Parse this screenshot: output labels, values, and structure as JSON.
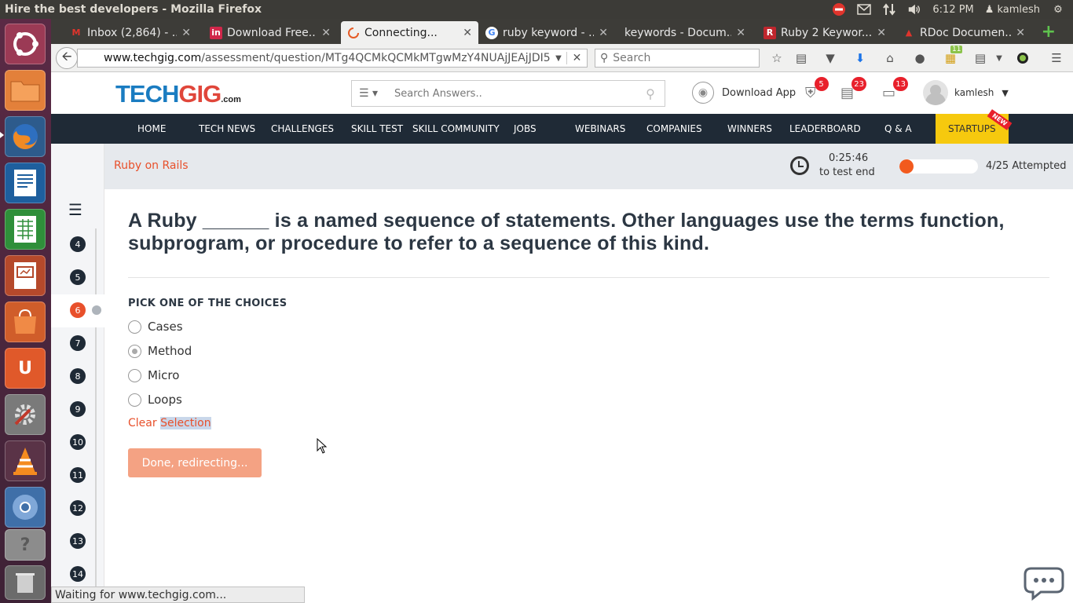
{
  "os_panel": {
    "window_title": "Hire the best developers - Mozilla Firefox",
    "time": "6:12 PM",
    "user": "kamlesh",
    "icons": [
      "no-entry-icon",
      "mail-icon",
      "network-icon",
      "volume-icon",
      "gear-icon"
    ]
  },
  "launcher": {
    "items": [
      "ubuntu-dash-icon",
      "files-icon",
      "firefox-icon",
      "writer-icon",
      "calc-icon",
      "impress-icon",
      "software-center-icon",
      "ubuntu-one-icon",
      "system-settings-icon",
      "vlc-icon",
      "chromium-icon",
      "help-icon",
      "trash-icon"
    ]
  },
  "browser": {
    "tabs": [
      {
        "label": "Inbox (2,864) - ...",
        "icon": "gmail-icon"
      },
      {
        "label": "Download Free...",
        "icon": "indeed-icon"
      },
      {
        "label": "Connecting...",
        "icon": "loading-icon"
      },
      {
        "label": "ruby keyword - ...",
        "icon": "google-icon"
      },
      {
        "label": "keywords - Docum...",
        "icon": "none"
      },
      {
        "label": "Ruby 2 Keywor...",
        "icon": "ruby-doc-icon"
      },
      {
        "label": "RDoc Documen...",
        "icon": "rdoc-icon"
      }
    ],
    "url_host": "www.techgig.com",
    "url_path": "/assessment/question/MTg4QCMkQCMkMTgwMzY4NUAjJEAjJDI5",
    "search_placeholder": "Search",
    "toolbar_badge": "11",
    "status": "Waiting for www.techgig.com..."
  },
  "site": {
    "logo_tech": "TECH",
    "logo_gig": "GIG",
    "logo_com": ".com",
    "search_placeholder": "Search Answers..",
    "download_app": "Download App",
    "badges": {
      "shield": "5",
      "news": "23",
      "monitor": "13"
    },
    "username": "kamlesh",
    "nav": [
      "HOME",
      "TECH NEWS",
      "CHALLENGES",
      "SKILL TEST",
      "SKILL COMMUNITY",
      "JOBS",
      "WEBINARS",
      "COMPANIES",
      "WINNERS",
      "LEADERBOARD",
      "Q & A",
      "STARTUPS"
    ],
    "new_ribbon": "NEW"
  },
  "test": {
    "name": "Ruby on Rails",
    "timer": "0:25:46",
    "timer_label": "to test end",
    "attempted": "4/25 Attempted",
    "progress_fraction": 0.16,
    "question_numbers": [
      "4",
      "5",
      "6",
      "7",
      "8",
      "9",
      "10",
      "11",
      "12",
      "13",
      "14"
    ],
    "current_question": "6",
    "question": "A Ruby ______ is a named sequence of statements. Other languages use the terms function, subprogram, or procedure to refer to a sequence of this kind.",
    "pick_label": "PICK ONE OF THE CHOICES",
    "choices": [
      {
        "label": "Cases",
        "selected": false
      },
      {
        "label": "Method",
        "selected": true
      },
      {
        "label": "Micro",
        "selected": false
      },
      {
        "label": "Loops",
        "selected": false
      }
    ],
    "clear_word1": "Clear",
    "clear_word2": "Selection",
    "done_button": "Done, redirecting..."
  },
  "colors": {
    "accent_orange": "#e8502b",
    "nav_dark": "#1f2a36",
    "startups_yellow": "#f6c90e",
    "done_button": "#f4a283"
  }
}
